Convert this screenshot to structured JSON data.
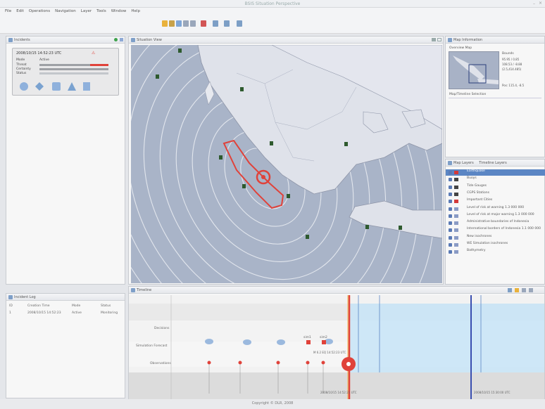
{
  "window": {
    "title": "BSIS Situation Perspective"
  },
  "menu": [
    "File",
    "Edit",
    "Operations",
    "Navigation",
    "Layer",
    "Tools",
    "Window",
    "Help"
  ],
  "incidents": {
    "tab": "Incidents",
    "card": {
      "time": "2008/10/15 14:52:23 UTC",
      "mode_label": "Mode",
      "mode_value": "Active",
      "threat_label": "Threat",
      "certainty_label": "Certainty",
      "status_label": "Status",
      "threat_color": "#e0423a"
    }
  },
  "incident_log": {
    "tab": "Incident Log",
    "headers": [
      "ID",
      "Creation Time",
      "Mode",
      "Status"
    ],
    "rows": [
      [
        "1",
        "2008/10/15 14:52:23",
        "Active",
        "Monitoring"
      ]
    ]
  },
  "map_tab": "Situation View",
  "map_information": {
    "tab": "Map Information",
    "overview": "Overview Map",
    "bounds_label": "Bounds",
    "bounds": [
      "95.95 / 0.85",
      "108.53 / -8.88",
      "(2.5,414.485)"
    ],
    "pos": "Pos: 115.4, -8.5",
    "selection": "Map/Timeline Selection"
  },
  "layers": {
    "tabs": [
      "Map Layers",
      "Timeline Layers"
    ],
    "items": [
      {
        "label": "Earthquake",
        "color": "#d43a3a",
        "selected": true
      },
      {
        "label": "Buoys",
        "color": "#444"
      },
      {
        "label": "Tide Gauges",
        "color": "#444"
      },
      {
        "label": "CGPS Stations",
        "color": "#444"
      },
      {
        "label": "Important Cities",
        "color": "#d43a3a"
      },
      {
        "label": "Level of risk at warning 1.3 000 000",
        "color": "#8a9bc5"
      },
      {
        "label": "Level of risk at major warning 1.3 000 000",
        "color": "#8a9bc5"
      },
      {
        "label": "Administrative boundaries of Indonesia",
        "color": "#8a9bc5"
      },
      {
        "label": "International borders of Indonesia 1.1 000 000",
        "color": "#8a9bc5"
      },
      {
        "label": "New isochrones",
        "color": "#8a9bc5"
      },
      {
        "label": "WE Simulation isochrones",
        "color": "#8a9bc5"
      },
      {
        "label": "Bathymetry",
        "color": "#8a9bc5"
      }
    ]
  },
  "timeline": {
    "tab": "Timeline",
    "rows": [
      "Decisions",
      "Simulation Forecast",
      "Observations"
    ],
    "sim_labels": [
      "sim1",
      "sim2"
    ],
    "obs_text": "M 6.2 EQ 14:52:23 UTC",
    "footer_left": "2008/10/15 14:52:23 UTC",
    "footer_right": "2008/10/15 15:30:00 UTC"
  },
  "status": {
    "copyright": "Copyright © DLR, 2008"
  },
  "colors": {
    "ocean": "#a8b2c6",
    "land": "#dfe2ea",
    "accent": "#e0423a",
    "timeline_blue": "#c7e4f7"
  }
}
